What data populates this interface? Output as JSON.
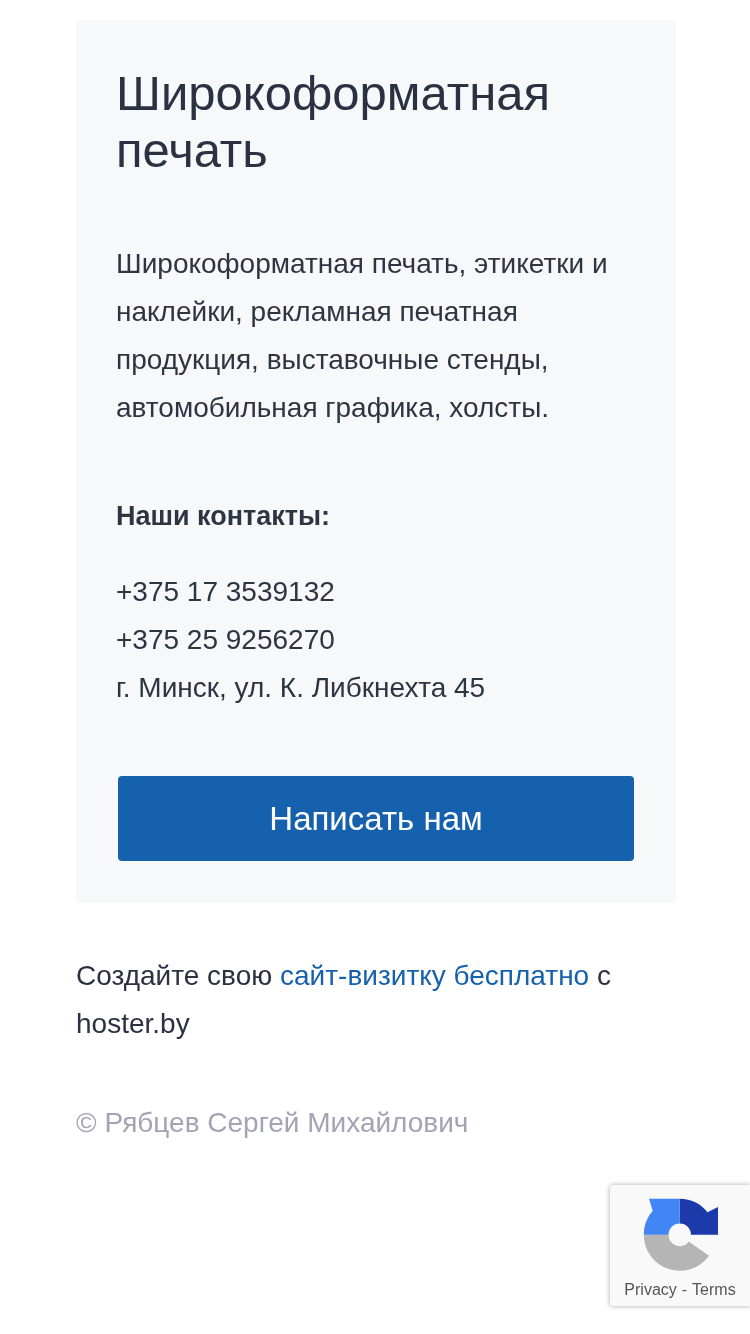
{
  "card": {
    "title": "Широкоформатная печать",
    "description": "Широкоформатная печать, этикетки и наклейки, рекламная печатная продукция, выставочные стенды, автомобильная графика, холсты.",
    "contacts_heading": "Наши контакты:",
    "phones": [
      "+375 17 3539132",
      "+375 25 9256270"
    ],
    "address": "г. Минск, ул. К. Либкнехта 45",
    "button": "Написать нам"
  },
  "footer": {
    "promo": {
      "before": "Создайте свою",
      "link": "сайт-визитку бесплатно",
      "after": "с hoster.by"
    },
    "copyright": "© Рябцев Сергей Михайлович"
  },
  "recaptcha_badge": {
    "privacy": "Privacy",
    "separator": "-",
    "terms": "Terms"
  }
}
